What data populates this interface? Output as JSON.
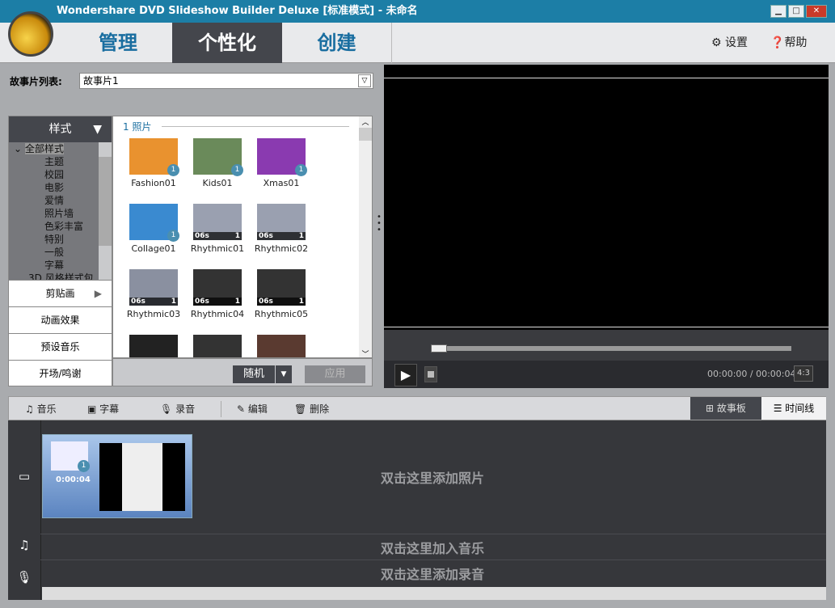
{
  "window": {
    "title": "Wondershare DVD Slideshow Builder Deluxe [标准模式] - 未命名",
    "minimize": "▁",
    "maximize": "□",
    "close": "✕"
  },
  "nav": {
    "tabs": [
      {
        "label": "管理"
      },
      {
        "label": "个性化"
      },
      {
        "label": "创建"
      }
    ],
    "settings": "设置",
    "help": "帮助"
  },
  "story": {
    "label": "故事片列表:",
    "value": "故事片1"
  },
  "styles": {
    "header": "样式",
    "tree": [
      "全部样式",
      "主题",
      "校园",
      "电影",
      "爱情",
      "照片墙",
      "色彩丰富",
      "特别",
      "一般",
      "字幕",
      "3D 风格样式包"
    ],
    "buttons": [
      "剪贴画",
      "动画效果",
      "预设音乐",
      "开场/鸣谢"
    ]
  },
  "grid": {
    "section": "1 照片",
    "items": [
      {
        "name": "Fashion01",
        "badge": "1",
        "cap": "",
        "color": "#e9922f"
      },
      {
        "name": "Kids01",
        "badge": "1",
        "cap": "",
        "color": "#6a8a5a"
      },
      {
        "name": "Xmas01",
        "badge": "1",
        "cap": "",
        "color": "#8a3ab0"
      },
      {
        "name": "Collage01",
        "badge": "1",
        "cap": "",
        "color": "#3a8ad0"
      },
      {
        "name": "Rhythmic01",
        "badge": "",
        "cap": "06s",
        "n": "1",
        "color": "#9aa0b0"
      },
      {
        "name": "Rhythmic02",
        "badge": "",
        "cap": "06s",
        "n": "1",
        "color": "#9aa0b0"
      },
      {
        "name": "Rhythmic03",
        "badge": "",
        "cap": "06s",
        "n": "1",
        "color": "#8a90a0"
      },
      {
        "name": "Rhythmic04",
        "badge": "",
        "cap": "06s",
        "n": "1",
        "color": "#333"
      },
      {
        "name": "Rhythmic05",
        "badge": "",
        "cap": "06s",
        "n": "1",
        "color": "#333"
      },
      {
        "name": "",
        "badge": "",
        "cap": "",
        "color": "#222"
      },
      {
        "name": "",
        "badge": "",
        "cap": "",
        "color": "#333"
      },
      {
        "name": "",
        "badge": "",
        "cap": "",
        "color": "#5a3a30"
      }
    ],
    "random": "随机",
    "apply": "应用"
  },
  "player": {
    "time": "00:00:00 / 00:00:04",
    "aspect": "4:3",
    "progress": 0
  },
  "toolbar": {
    "music": "音乐",
    "subtitle": "字幕",
    "record": "录音",
    "edit": "编辑",
    "delete": "删除",
    "storyboard": "故事板",
    "timeline": "时间线"
  },
  "timeline": {
    "clip_duration": "0:00:04",
    "clip_badge": "1",
    "photo_hint": "双击这里添加照片",
    "music_hint": "双击这里加入音乐",
    "record_hint": "双击这里添加录音"
  }
}
